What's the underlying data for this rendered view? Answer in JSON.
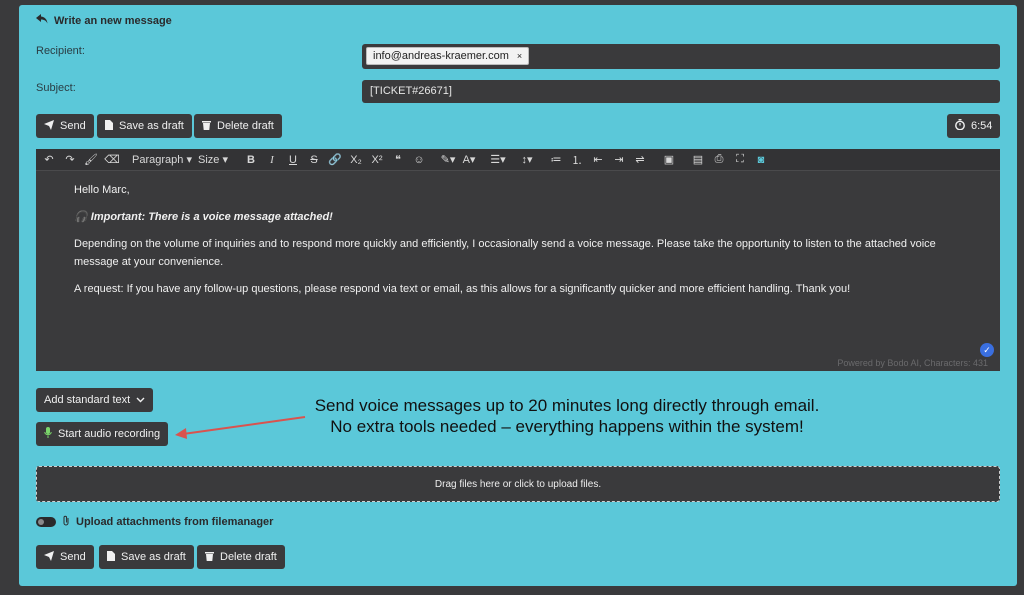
{
  "header": {
    "title": "Write an new message",
    "icon": "reply-icon"
  },
  "recipient": {
    "label": "Recipient:",
    "chip": "info@andreas-kraemer.com",
    "chip_remove": "×"
  },
  "subject": {
    "label": "Subject:",
    "value": "[TICKET#26671]"
  },
  "actions_top": {
    "send": "Send",
    "save_draft": "Save as draft",
    "delete_draft": "Delete draft",
    "timer": "6:54"
  },
  "toolbar": {
    "paragraph": "Paragraph",
    "size": "Size",
    "bold": "B",
    "italic": "I",
    "underline": "U",
    "strike": "S",
    "subscript": "X₂",
    "superscript": "X²",
    "quote": "❝",
    "font_color": "A"
  },
  "editor": {
    "greeting": "Hello Marc,",
    "important": "Important: There is a voice message attached!",
    "para1": "Depending on the volume of inquiries and to respond more quickly and efficiently, I occasionally send a voice message. Please take the opportunity to listen to the attached voice message at your convenience.",
    "para2": "A request: If you have any follow-up questions, please respond via text or email, as this allows for a significantly quicker and more efficient handling. Thank you!",
    "footer": "Powered by Bodo AI, Characters: 431"
  },
  "standard_text": {
    "label": "Add standard text"
  },
  "audio": {
    "label": "Start audio recording"
  },
  "annotation": {
    "line1": "Send voice messages up to 20 minutes long directly through email.",
    "line2": "No extra tools needed – everything happens within the system!"
  },
  "dropzone": {
    "text": "Drag files here or click to upload files."
  },
  "filemanager": {
    "label": "Upload attachments from filemanager"
  },
  "actions_bottom": {
    "send": "Send",
    "save_draft": "Save as draft",
    "delete_draft": "Delete draft"
  },
  "colors": {
    "panel": "#5bc8d9",
    "dark": "#3a3a3c",
    "arrow": "#d9534f",
    "accent": "#3a6fe0"
  }
}
